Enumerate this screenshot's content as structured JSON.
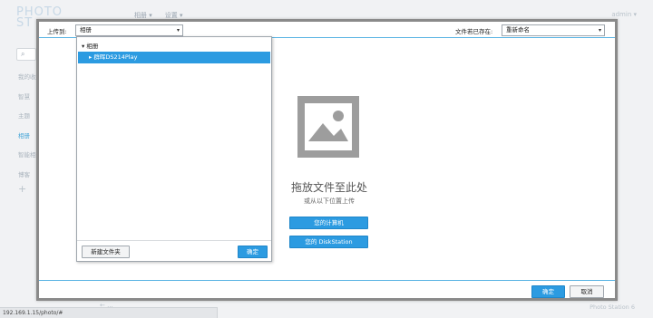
{
  "background": {
    "logo": [
      "PHOTO",
      "ST"
    ],
    "topnav": [
      "相册 ▾",
      "设置 ▾"
    ],
    "topright": "admin ▾",
    "search_icon": "⌕",
    "sidebar": [
      "我的收藏",
      "智慧",
      "主题",
      "相册",
      "智能相册",
      "博客"
    ],
    "add_icon": "+",
    "footer": "Photo Station 6",
    "bottom_left": "←   ...",
    "status_url": "192.169.1.15/photo/#"
  },
  "dialog": {
    "upload_to_label": "上传到:",
    "upload_to_value": "相册",
    "file_exists_label": "文件若已存在:",
    "file_exists_value": "重新命名",
    "drop_title": "拖放文件至此处",
    "drop_sub": "或从以下位置上传",
    "btn_computer": "您的计算机",
    "btn_diskstation": "您的 DiskStation",
    "ok": "确定",
    "cancel": "取消"
  },
  "folder_panel": {
    "root": "相册",
    "selected": "群晖DS214Play",
    "new_folder": "新建文件夹",
    "ok": "确定"
  },
  "icons": {
    "caret": "▾",
    "tree_expanded": "▾",
    "tree_collapsed": "▸",
    "image_placeholder": "image-icon"
  }
}
